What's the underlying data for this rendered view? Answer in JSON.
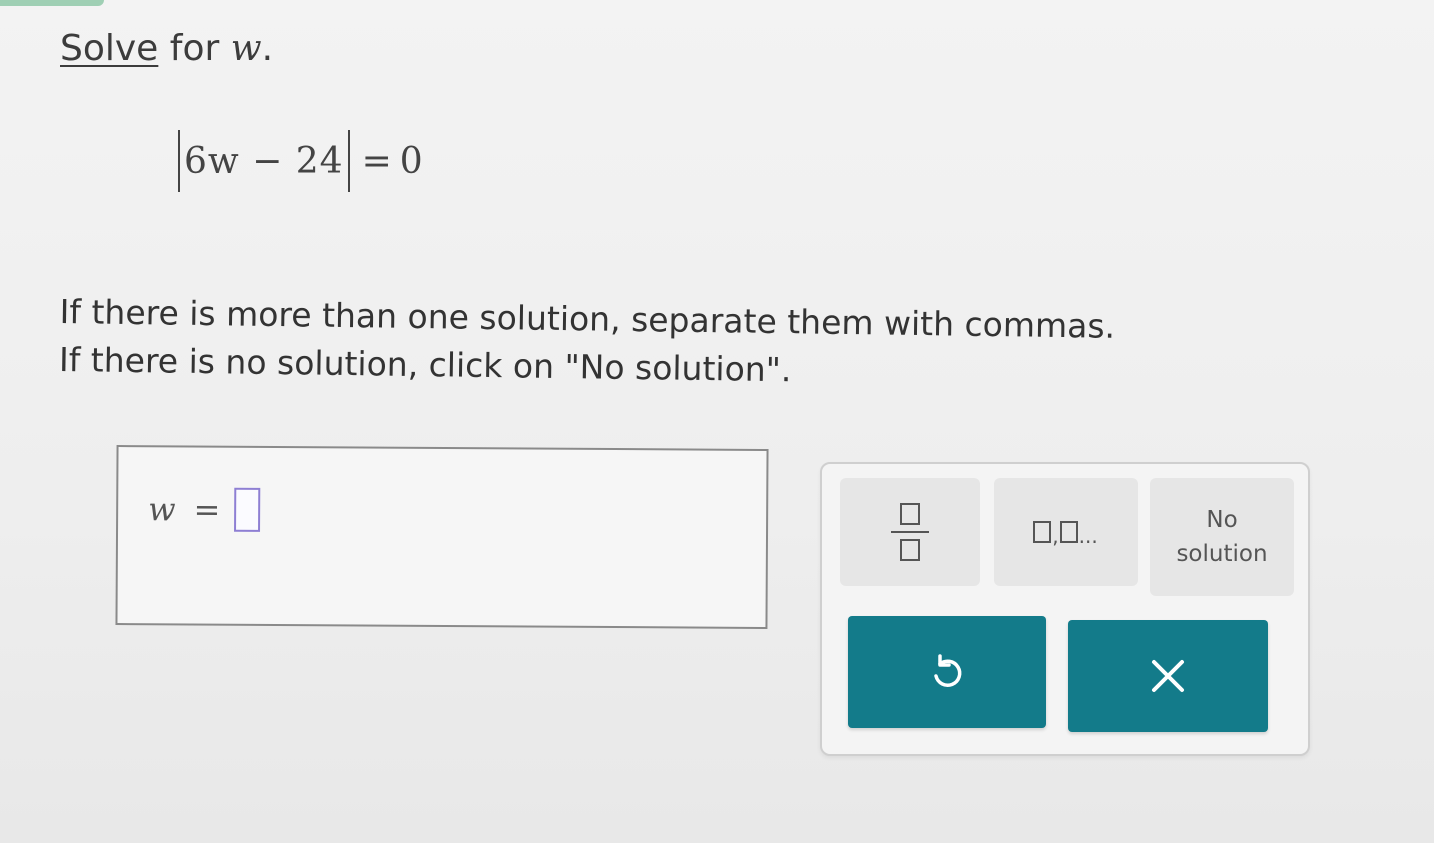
{
  "prompt": {
    "solve_link": "Solve",
    "for_text": "for",
    "variable": "w",
    "period": "."
  },
  "equation": {
    "expression": "6w − 24",
    "equals": "=",
    "rhs": "0"
  },
  "instructions": {
    "line1": "If there is more than one solution, separate them with commas.",
    "line2": "If there is no solution, click on \"No solution\"."
  },
  "answer": {
    "variable": "w",
    "equals": "=",
    "value": ""
  },
  "keypad": {
    "list_ellipsis": "...",
    "list_comma": ",",
    "no_solution_line1": "No",
    "no_solution_line2": "solution",
    "undo_icon": "undo-icon",
    "clear_icon": "close-icon"
  },
  "colors": {
    "accent": "#137b8a",
    "input_border": "#8e7fd3",
    "top_tab": "#9fcfb4"
  }
}
